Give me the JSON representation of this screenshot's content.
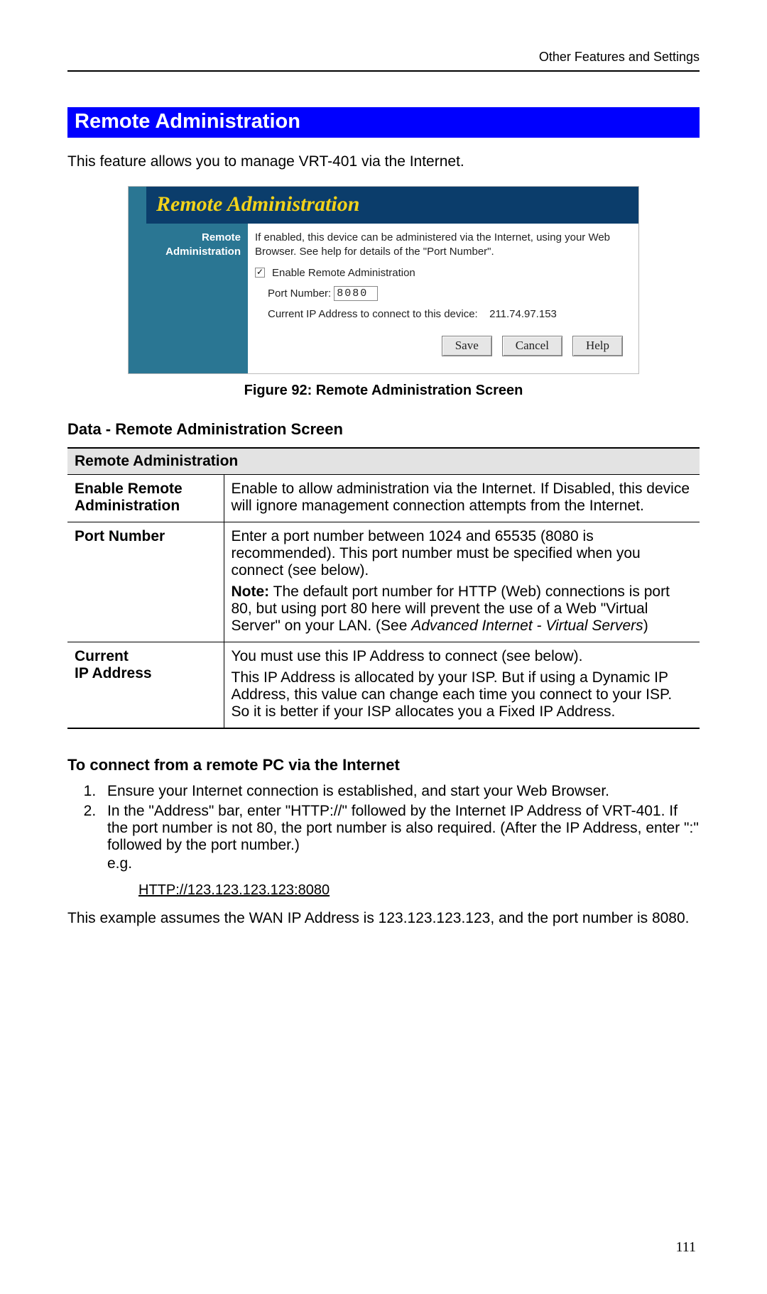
{
  "header": {
    "breadcrumb": "Other Features and Settings"
  },
  "section": {
    "title": "Remote Administration",
    "intro": "This feature allows you to manage VRT-401 via the Internet."
  },
  "screenshot": {
    "banner_title": "Remote Administration",
    "sidebar_line1": "Remote",
    "sidebar_line2": "Administration",
    "description": "If enabled, this device can be administered via the Internet, using your Web Browser. See help for details of the \"Port Number\".",
    "enable_label": "Enable Remote Administration",
    "port_label": "Port Number:",
    "port_value": "8080",
    "current_ip_label": "Current IP Address to connect to this device:",
    "current_ip_value": "211.74.97.153",
    "buttons": {
      "save": "Save",
      "cancel": "Cancel",
      "help": "Help"
    }
  },
  "figure_caption": "Figure 92: Remote Administration Screen",
  "data_section_heading": "Data - Remote Administration Screen",
  "table": {
    "group_header": "Remote Administration",
    "rows": [
      {
        "term": "Enable Remote Administration",
        "desc_paras": [
          "Enable to allow administration via the Internet. If Disabled, this device will ignore management connection attempts from the Internet."
        ],
        "note": null
      },
      {
        "term": "Port Number",
        "desc_paras": [
          "Enter a port number between 1024 and 65535 (8080 is recommended). This port number must be specified when you connect (see below)."
        ],
        "note": {
          "label": "Note:",
          "text_before_italics": " The default port number for HTTP (Web) connections is port 80, but using port 80 here will prevent the use of a Web \"Virtual Server\" on your LAN. (See ",
          "italics": "Advanced Internet - Virtual Servers",
          "text_after": ")"
        }
      },
      {
        "term": "Current IP Address",
        "desc_paras": [
          "You must use this IP Address to connect (see below).",
          "This IP Address is allocated by your ISP. But if using a Dynamic IP Address, this value can change each time you connect to your ISP. So it is better if your ISP allocates you a Fixed IP Address."
        ],
        "note": null
      }
    ]
  },
  "connect": {
    "heading": "To connect from a remote PC via the Internet",
    "steps": [
      {
        "text": "Ensure your Internet connection is established, and start your Web Browser."
      },
      {
        "text": "In the \"Address\" bar, enter \"HTTP://\" followed by the Internet IP Address of VRT-401. If the port number is not 80, the port number is also required. (After the IP Address, enter \":\" followed by the port number.)",
        "eg": "e.g."
      }
    ],
    "url_example": "HTTP://123.123.123.123:8080",
    "closing": "This example assumes the WAN IP Address is 123.123.123.123, and the port number is 8080."
  },
  "page_number": "111"
}
